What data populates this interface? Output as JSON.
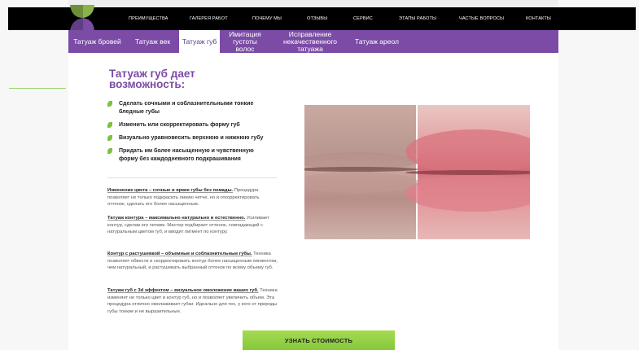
{
  "nav": {
    "items": [
      "ПРЕИМУЩЕСТВА",
      "ГАЛЕРЕЯ РАБОТ",
      "ПОЧЕМУ МЫ",
      "ОТЗЫВЫ",
      "СЕРВИС",
      "ЭТАПЫ РАБОТЫ",
      "ЧАСТЫЕ ВОПРОСЫ",
      "КОНТАКТЫ"
    ]
  },
  "tabs": [
    {
      "label": "Татуаж бровей"
    },
    {
      "label": "Татуаж век"
    },
    {
      "label": "Татуаж губ"
    },
    {
      "label": "Имитация густоты волос"
    },
    {
      "label": "Исправление некачественного татуажа"
    },
    {
      "label": "Татуаж ареол"
    }
  ],
  "main": {
    "title": "Татуаж губ дает возможность:",
    "bullets": [
      "Сделать сочными и соблазнительными тонкие бледные губы",
      "Изменить или скорректировать форму губ",
      "Визуально уравновесить верхнюю и нижнюю губу",
      "Придать им более насыщенную и чувственную форму без каждодневного подкрашивания"
    ],
    "paragraphs": [
      {
        "bold": "Изменение цвета – сочные и яркие губы без помады.",
        "text": " Процедура позволяет не только подкрасить линию четче, но и откорректировать оттенок, сделать его более насыщенным."
      },
      {
        "bold": "Татуаж контура – максимально натурально и естественно.",
        "text": " Усиливает контур, сделав его четким. Мастер подбирает оттенок, совпадающий с натуральным цветом губ, и вводит пигмент по контуру."
      },
      {
        "bold": "Контур с растушевкой – объемные и соблазнительные губы.",
        "text": " Техника позволяет обвести и скорректировать контур более насыщенным пигментом, чем натуральный, и растушевать выбранный оттенок по всему объему губ."
      },
      {
        "bold": "Татуаж губ с 3d эффектом – визуальное омоложение ваших губ.",
        "text": " Техника изменяет не только цвет и контур губ, но и позволяет увеличить объем. Эта процедура отлично омолаживает губки. Идеально для тех, у кого от природы губы тонкие и не выразительные."
      }
    ],
    "cta_label": "УЗНАТЬ СТОИМОСТЬ"
  },
  "slider": {
    "prev_icon": "chevron-left-icon",
    "next_icon": "chevron-right-icon"
  },
  "colors": {
    "accent": "#7b4ba5",
    "cta": "#8fcd41",
    "topbar": "#000000"
  }
}
